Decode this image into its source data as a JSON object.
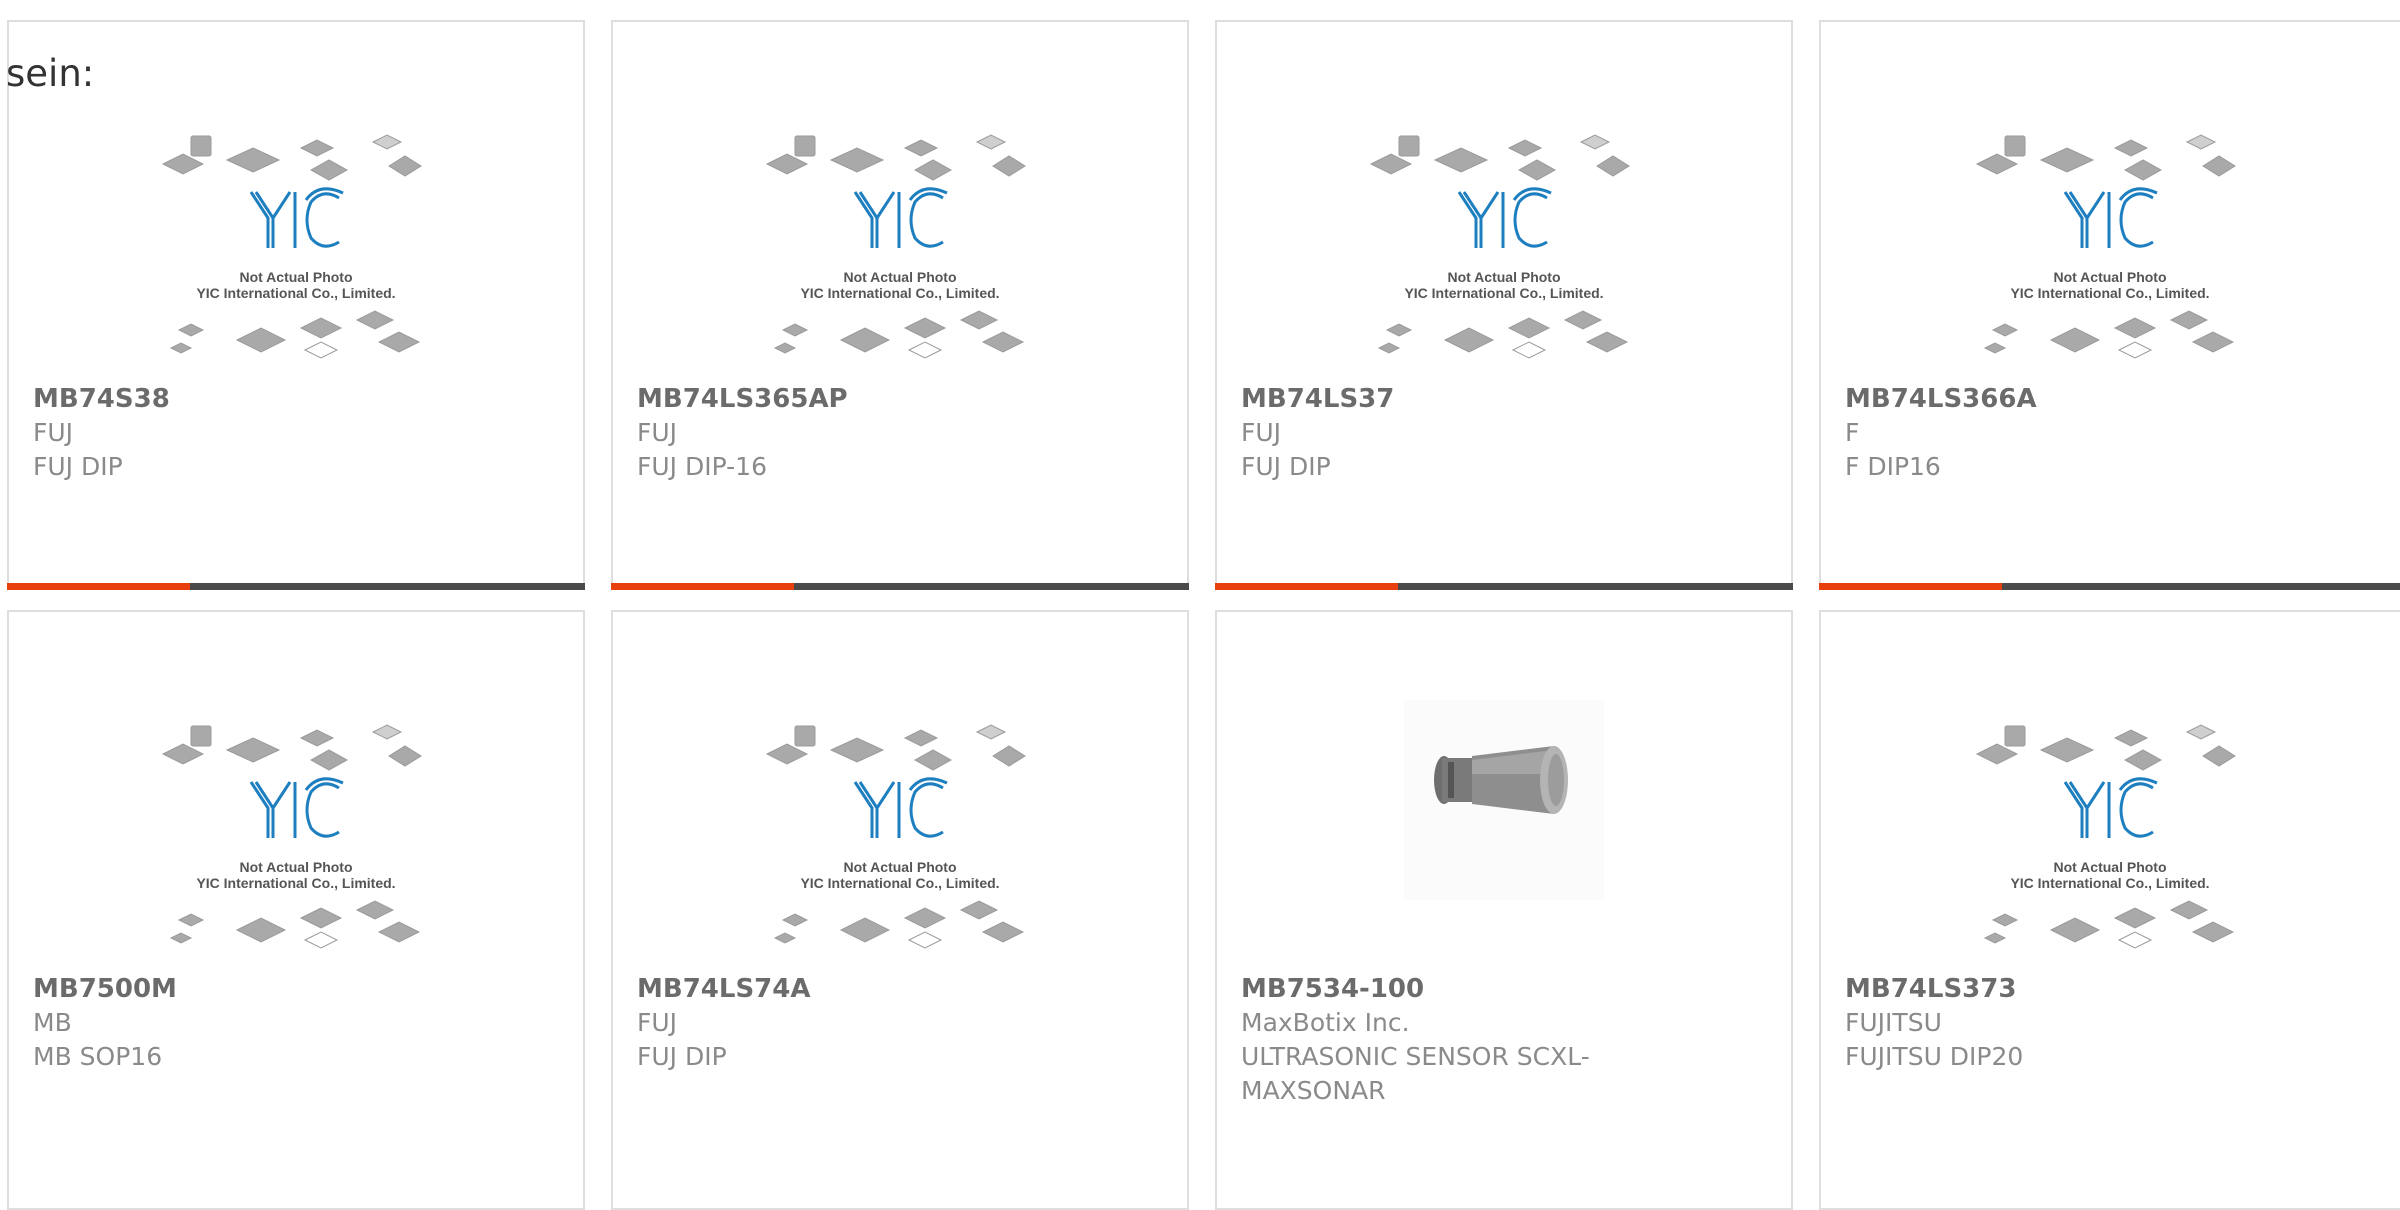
{
  "intro_text": "sein:",
  "placeholder": {
    "line1": "Not Actual Photo",
    "line2": "YIC International Co., Limited."
  },
  "products": [
    {
      "part": "MB74S38",
      "manufacturer": "FUJ",
      "description": "FUJ DIP",
      "image": "placeholder"
    },
    {
      "part": "MB74LS365AP",
      "manufacturer": "FUJ",
      "description": "FUJ DIP-16",
      "image": "placeholder"
    },
    {
      "part": "MB74LS37",
      "manufacturer": "FUJ",
      "description": "FUJ DIP",
      "image": "placeholder"
    },
    {
      "part": "MB74LS366A",
      "manufacturer": "F",
      "description": "F DIP16",
      "image": "placeholder"
    },
    {
      "part": "MB7500M",
      "manufacturer": "MB",
      "description": "MB SOP16",
      "image": "placeholder"
    },
    {
      "part": "MB74LS74A",
      "manufacturer": "FUJ",
      "description": "FUJ DIP",
      "image": "placeholder"
    },
    {
      "part": "MB7534-100",
      "manufacturer": "MaxBotix Inc.",
      "description": "ULTRASONIC SENSOR SCXL-MAXSONAR",
      "image": "ultrasonic-sensor"
    },
    {
      "part": "MB74LS373",
      "manufacturer": "FUJITSU",
      "description": "FUJITSU DIP20",
      "image": "placeholder"
    }
  ],
  "colors": {
    "accent": "#e8400c",
    "bar": "#4a4a4a",
    "logo": "#1e7fc0"
  }
}
